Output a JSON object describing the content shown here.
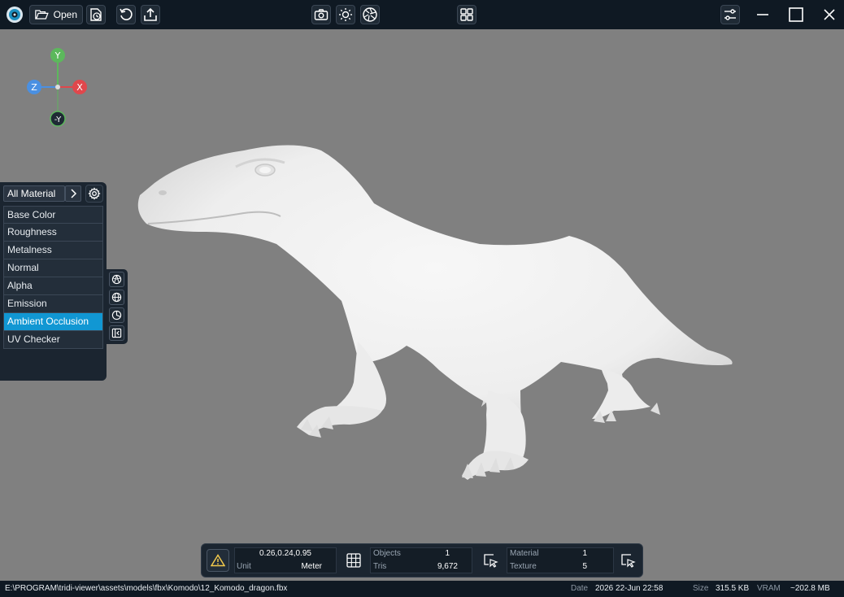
{
  "toolbar": {
    "open_label": "Open"
  },
  "gizmo": {
    "y_label": "Y",
    "x_label": "X",
    "z_label": "Z",
    "neg_y_label": "-Y"
  },
  "material_panel": {
    "selected": "All Material",
    "items": [
      {
        "label": "Base Color"
      },
      {
        "label": "Roughness"
      },
      {
        "label": "Metalness"
      },
      {
        "label": "Normal"
      },
      {
        "label": "Alpha"
      },
      {
        "label": "Emission"
      },
      {
        "label": "Ambient Occlusion"
      },
      {
        "label": "UV Checker"
      }
    ],
    "active_index": 6
  },
  "stats": {
    "dimensions": "0.26,0.24,0.95",
    "unit_label": "Unit",
    "unit_value": "Meter",
    "objects_label": "Objects",
    "objects_value": "1",
    "tris_label": "Tris",
    "tris_value": "9,672",
    "material_label": "Material",
    "material_value": "1",
    "texture_label": "Texture",
    "texture_value": "5"
  },
  "statusbar": {
    "path": "E:\\PROGRAM\\tridi-viewer\\assets\\models\\fbx\\Komodo\\12_Komodo_dragon.fbx",
    "date_label": "Date",
    "date_value": "2026 22-Jun 22:58",
    "size_label": "Size",
    "size_value": "315.5 KB",
    "vram_label": "VRAM",
    "vram_value": "~202.8 MB"
  },
  "colors": {
    "accent": "#1197d3",
    "background": "#808080",
    "bar": "#0f1923",
    "axis_x": "#e0474c",
    "axis_y": "#5cb85c",
    "axis_z": "#4a90e2"
  }
}
